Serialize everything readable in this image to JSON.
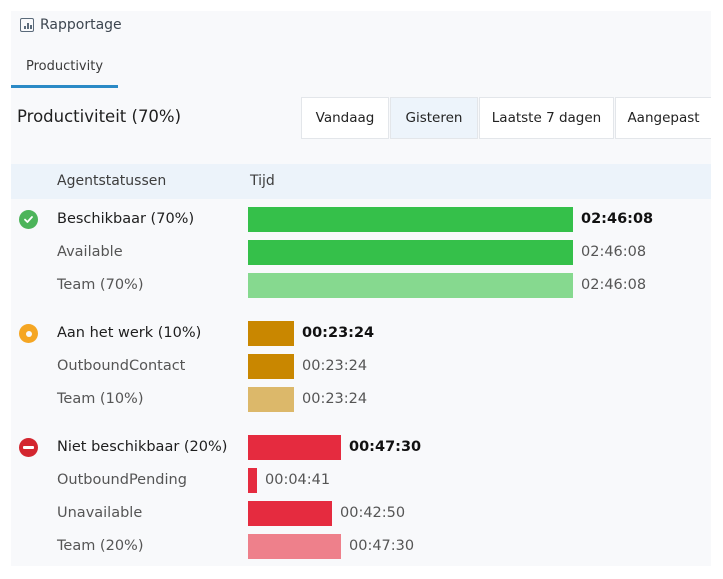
{
  "app": {
    "title": "Rapportage",
    "icon": "bar-chart-icon"
  },
  "tabs": [
    {
      "label": "Productivity",
      "active": true
    }
  ],
  "section": {
    "title": "Productiviteit (70%)",
    "ranges": [
      {
        "label": "Vandaag",
        "selected": false
      },
      {
        "label": "Gisteren",
        "selected": true
      },
      {
        "label": "Laatste 7 dagen",
        "selected": false
      },
      {
        "label": "Aangepast",
        "selected": false
      }
    ]
  },
  "table": {
    "columns": [
      "Agentstatussen",
      "Tijd"
    ],
    "max_time": "02:46:08",
    "groups": [
      {
        "status": "available",
        "icon": "check-circle-icon",
        "color": "#35c04a",
        "team_color": "#86d98f",
        "rows": [
          {
            "label": "Beschikbaar (70%)",
            "time": "02:46:08",
            "type": "main"
          },
          {
            "label": "Available",
            "time": "02:46:08",
            "type": "sub"
          },
          {
            "label": "Team (70%)",
            "time": "02:46:08",
            "type": "team"
          }
        ]
      },
      {
        "status": "working",
        "icon": "ring-circle-icon",
        "color": "#c98700",
        "team_color": "#dcb86a",
        "rows": [
          {
            "label": "Aan het werk (10%)",
            "time": "00:23:24",
            "type": "main"
          },
          {
            "label": "OutboundContact",
            "time": "00:23:24",
            "type": "sub"
          },
          {
            "label": "Team (10%)",
            "time": "00:23:24",
            "type": "team"
          }
        ]
      },
      {
        "status": "unavailable",
        "icon": "no-entry-icon",
        "color": "#e52b3f",
        "team_color": "#ee808b",
        "rows": [
          {
            "label": "Niet beschikbaar (20%)",
            "time": "00:47:30",
            "type": "main"
          },
          {
            "label": "OutboundPending",
            "time": "00:04:41",
            "type": "sub"
          },
          {
            "label": "Unavailable",
            "time": "00:42:50",
            "type": "sub"
          },
          {
            "label": "Team (20%)",
            "time": "00:47:30",
            "type": "team"
          }
        ]
      }
    ]
  },
  "colors": {
    "accent": "#2b8ac6",
    "header_band": "#ecf3fa",
    "selected_range": "#edf4fb"
  }
}
